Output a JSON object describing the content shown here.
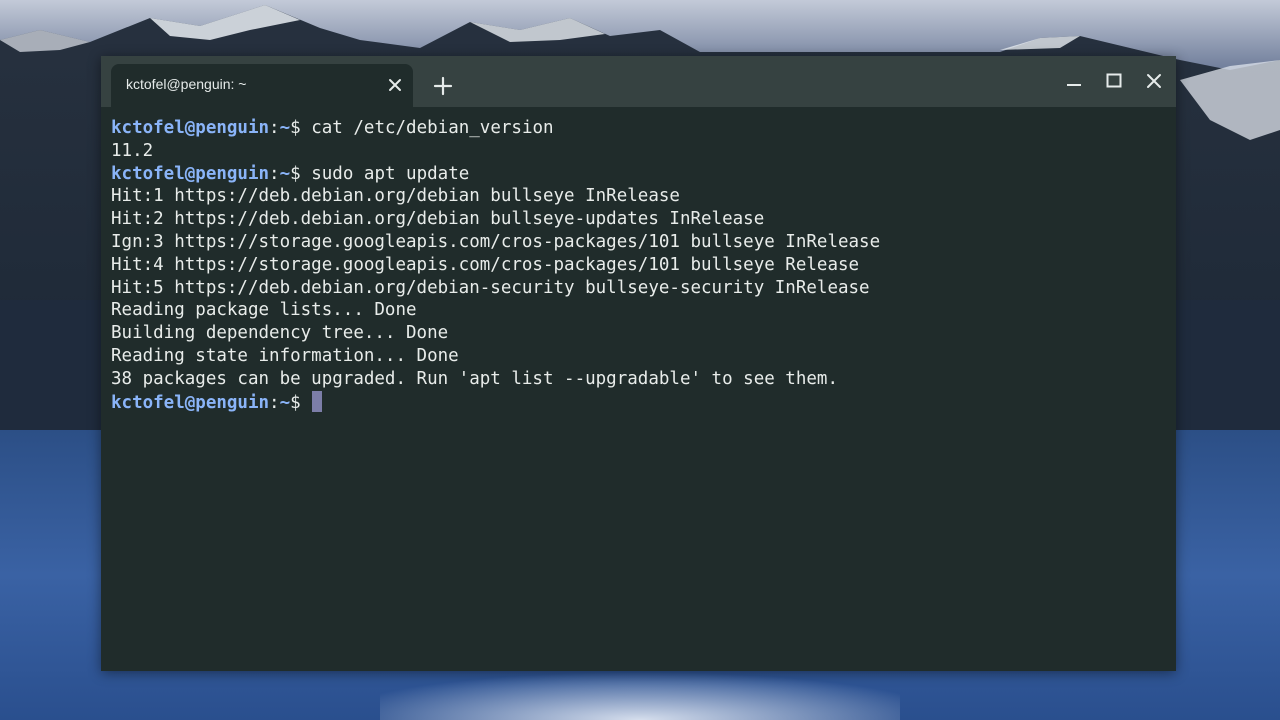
{
  "window": {
    "tab_title": "kctofel@penguin: ~"
  },
  "terminal": {
    "prompt": {
      "user_host": "kctofel@penguin",
      "separator": ":",
      "path": "~",
      "symbol": "$"
    },
    "lines": [
      {
        "type": "command",
        "text": " cat /etc/debian_version"
      },
      {
        "type": "output",
        "text": "11.2"
      },
      {
        "type": "command",
        "text": " sudo apt update"
      },
      {
        "type": "output",
        "text": "Hit:1 https://deb.debian.org/debian bullseye InRelease"
      },
      {
        "type": "output",
        "text": "Hit:2 https://deb.debian.org/debian bullseye-updates InRelease"
      },
      {
        "type": "output",
        "text": "Ign:3 https://storage.googleapis.com/cros-packages/101 bullseye InRelease"
      },
      {
        "type": "output",
        "text": "Hit:4 https://storage.googleapis.com/cros-packages/101 bullseye Release"
      },
      {
        "type": "output",
        "text": "Hit:5 https://deb.debian.org/debian-security bullseye-security InRelease"
      },
      {
        "type": "output",
        "text": "Reading package lists... Done"
      },
      {
        "type": "output",
        "text": "Building dependency tree... Done"
      },
      {
        "type": "output",
        "text": "Reading state information... Done"
      },
      {
        "type": "output",
        "text": "38 packages can be upgraded. Run 'apt list --upgradable' to see them."
      },
      {
        "type": "command",
        "text": " ",
        "cursor": true
      }
    ]
  },
  "colors": {
    "terminal_bg": "#202c2b",
    "titlebar_bg": "#364241",
    "prompt": "#8ab4f8",
    "text": "#e8ecea",
    "cursor": "#7c7ea8"
  },
  "icons": {
    "tab_close": "close-icon",
    "new_tab": "plus-icon",
    "minimize": "minimize-icon",
    "maximize": "maximize-icon",
    "close": "close-icon"
  }
}
